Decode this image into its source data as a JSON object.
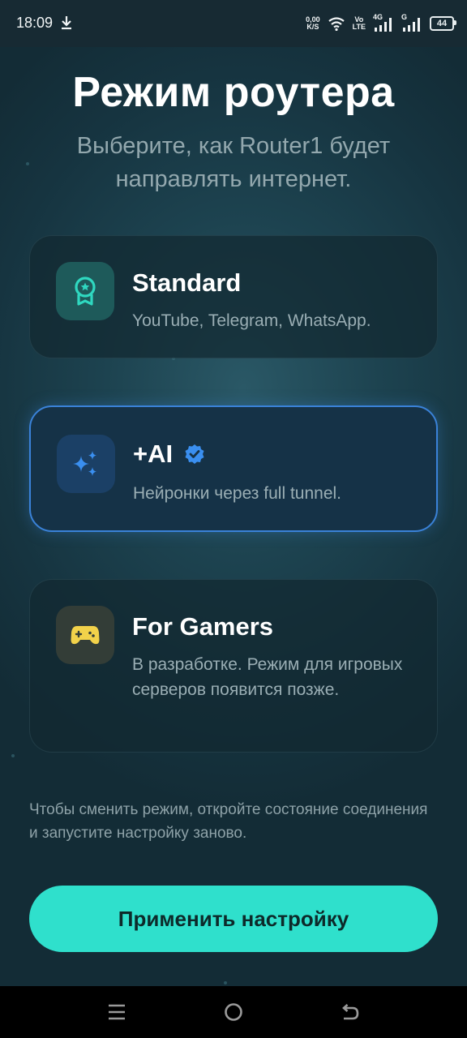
{
  "status_bar": {
    "time": "18:09",
    "speed_value": "0,00",
    "speed_unit": "K/S",
    "volte_top": "Vo",
    "volte_bottom": "LTE",
    "net1_label": "4G",
    "net2_label": "G",
    "battery": "44",
    "icons": [
      "download-icon",
      "wifi-icon",
      "signal-icon",
      "battery-icon"
    ]
  },
  "header": {
    "title": "Режим роутера",
    "subtitle": "Выберите, как Router1 будет направлять интернет."
  },
  "modes": [
    {
      "title": "Standard",
      "description": "YouTube, Telegram, WhatsApp.",
      "icon": "badge-icon",
      "selected": false
    },
    {
      "title": "+AI",
      "description": "Нейронки через full tunnel.",
      "icon": "sparkles-icon",
      "selected": true,
      "verified_icon": "verified-check-icon"
    },
    {
      "title": "For Gamers",
      "description": "В разработке. Режим для игровых серверов появится позже.",
      "icon": "gamepad-icon",
      "selected": false
    }
  ],
  "footer_note": "Чтобы сменить режим, откройте состояние соединения и запустите настройку заново.",
  "apply_button": "Применить настройку",
  "nav_bar": {
    "icons": [
      "menu-icon",
      "home-icon",
      "back-icon"
    ]
  },
  "colors": {
    "accent": "#2fe0cc",
    "selected_border": "#3a82d8",
    "standard_icon": "#2fd8c0",
    "ai_icon": "#3a8ff0",
    "gamers_icon": "#f2d24a"
  }
}
